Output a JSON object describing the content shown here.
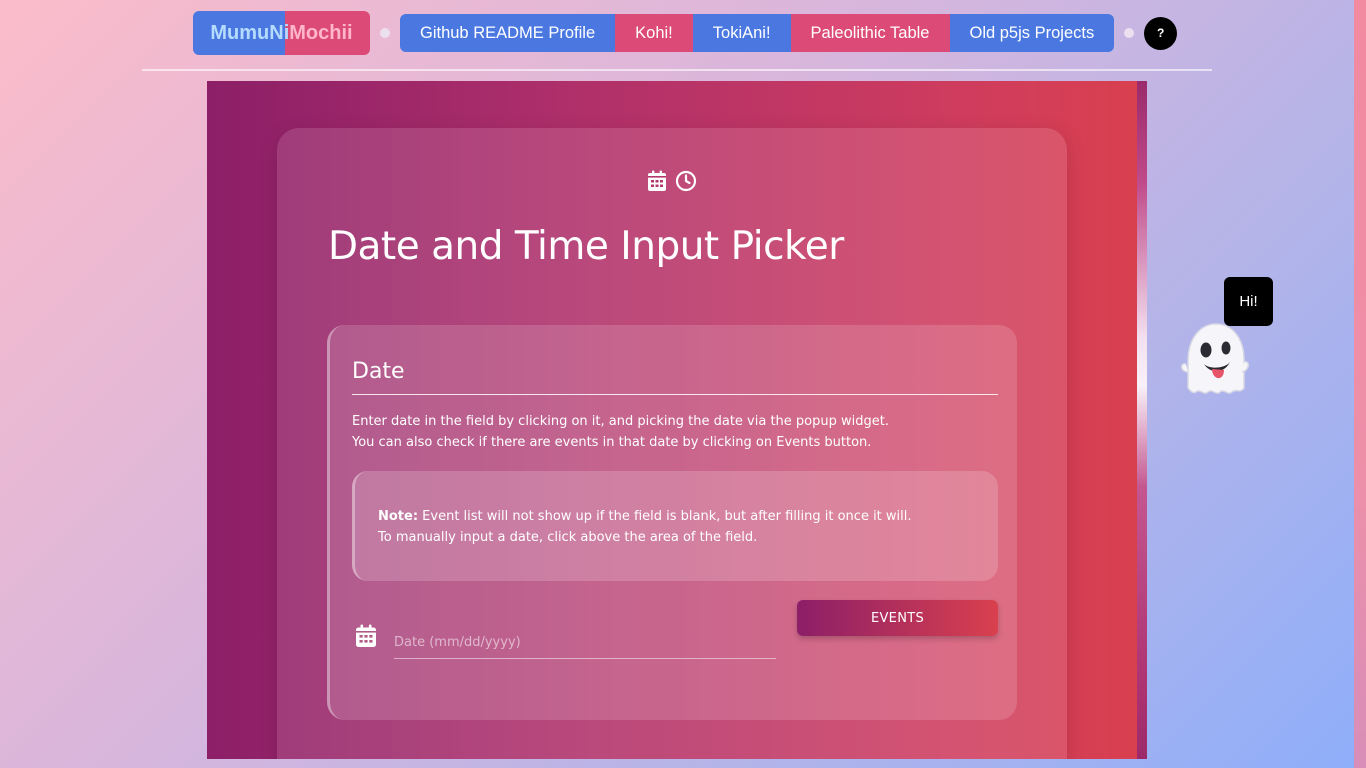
{
  "nav": {
    "brand_part1": "MumuNi",
    "brand_part2": "Mochii",
    "links": [
      {
        "label": "Github README Profile",
        "color": "#4a78e0"
      },
      {
        "label": "Kohi!",
        "color": "#dc4a78"
      },
      {
        "label": "TokiAni!",
        "color": "#4a78e0"
      },
      {
        "label": "Paleolithic Table",
        "color": "#dc4a78"
      },
      {
        "label": "Old p5js Projects",
        "color": "#4a78e0"
      }
    ],
    "help_label": "?"
  },
  "header": {
    "icons": [
      "calendar-icon",
      "clock-icon"
    ],
    "title": "Date and Time Input Picker"
  },
  "date_section": {
    "heading": "Date",
    "desc_line1": "Enter date in the field by clicking on it, and picking the date via the popup widget.",
    "desc_line2": "You can also check if there are events in that date by clicking on Events button.",
    "note_label": "Note:",
    "note_line1": " Event list will not show up if the field is blank, but after filling it once it will.",
    "note_line2": "To manually input a date, click above the area of the field.",
    "input_placeholder": "Date (mm/dd/yyyy)",
    "input_value": "",
    "events_label": "EVENTS"
  },
  "mascot": {
    "bubble_text": "Hi!",
    "icon": "ghost-icon"
  },
  "colors": {
    "brand_blue": "#4a78e0",
    "brand_pink": "#dc4a78",
    "frame_start": "#8c1f68",
    "frame_end": "#d9404e"
  }
}
